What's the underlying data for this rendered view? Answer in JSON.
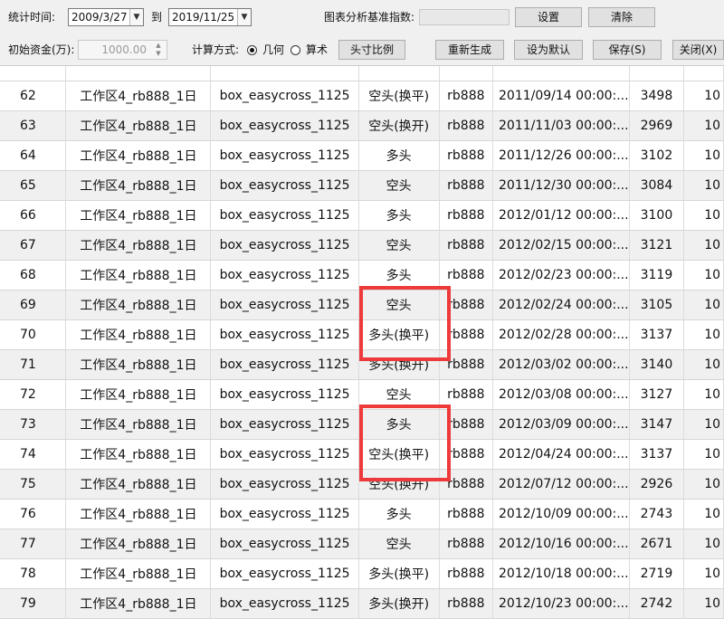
{
  "toolbar": {
    "stats_time_label": "统计时间:",
    "start_date": "2009/3/27",
    "to_label": "到",
    "end_date": "2019/11/25",
    "chart_index_label": "图表分析基准指数:",
    "settings_button": "设置",
    "clear_button": "清除",
    "initial_capital_label": "初始资金(万):",
    "initial_capital_value": "1000.00",
    "calc_method_label": "计算方式:",
    "geometric_label": "几何",
    "arithmetic_label": "算术",
    "selected_method": "几何",
    "position_ratio_button": "头寸比例",
    "regenerate_button": "重新生成",
    "set_default_button": "设为默认",
    "save_button": "保存(S)",
    "close_button": "关闭(X)"
  },
  "rows": [
    {
      "id": "62",
      "workspace": "工作区4_rb888_1日",
      "strategy": "box_easycross_1125",
      "direction": "空头(换平)",
      "symbol": "rb888",
      "time": "2011/09/14 00:00:...",
      "price": "3498",
      "tail": "10"
    },
    {
      "id": "63",
      "workspace": "工作区4_rb888_1日",
      "strategy": "box_easycross_1125",
      "direction": "空头(换开)",
      "symbol": "rb888",
      "time": "2011/11/03 00:00:...",
      "price": "2969",
      "tail": "10"
    },
    {
      "id": "64",
      "workspace": "工作区4_rb888_1日",
      "strategy": "box_easycross_1125",
      "direction": "多头",
      "symbol": "rb888",
      "time": "2011/12/26 00:00:...",
      "price": "3102",
      "tail": "10"
    },
    {
      "id": "65",
      "workspace": "工作区4_rb888_1日",
      "strategy": "box_easycross_1125",
      "direction": "空头",
      "symbol": "rb888",
      "time": "2011/12/30 00:00:...",
      "price": "3084",
      "tail": "10"
    },
    {
      "id": "66",
      "workspace": "工作区4_rb888_1日",
      "strategy": "box_easycross_1125",
      "direction": "多头",
      "symbol": "rb888",
      "time": "2012/01/12 00:00:...",
      "price": "3100",
      "tail": "10"
    },
    {
      "id": "67",
      "workspace": "工作区4_rb888_1日",
      "strategy": "box_easycross_1125",
      "direction": "空头",
      "symbol": "rb888",
      "time": "2012/02/15 00:00:...",
      "price": "3121",
      "tail": "10"
    },
    {
      "id": "68",
      "workspace": "工作区4_rb888_1日",
      "strategy": "box_easycross_1125",
      "direction": "多头",
      "symbol": "rb888",
      "time": "2012/02/23 00:00:...",
      "price": "3119",
      "tail": "10"
    },
    {
      "id": "69",
      "workspace": "工作区4_rb888_1日",
      "strategy": "box_easycross_1125",
      "direction": "空头",
      "symbol": "rb888",
      "time": "2012/02/24 00:00:...",
      "price": "3105",
      "tail": "10"
    },
    {
      "id": "70",
      "workspace": "工作区4_rb888_1日",
      "strategy": "box_easycross_1125",
      "direction": "多头(换平)",
      "symbol": "rb888",
      "time": "2012/02/28 00:00:...",
      "price": "3137",
      "tail": "10"
    },
    {
      "id": "71",
      "workspace": "工作区4_rb888_1日",
      "strategy": "box_easycross_1125",
      "direction": "多头(换开)",
      "symbol": "rb888",
      "time": "2012/03/02 00:00:...",
      "price": "3140",
      "tail": "10"
    },
    {
      "id": "72",
      "workspace": "工作区4_rb888_1日",
      "strategy": "box_easycross_1125",
      "direction": "空头",
      "symbol": "rb888",
      "time": "2012/03/08 00:00:...",
      "price": "3127",
      "tail": "10"
    },
    {
      "id": "73",
      "workspace": "工作区4_rb888_1日",
      "strategy": "box_easycross_1125",
      "direction": "多头",
      "symbol": "rb888",
      "time": "2012/03/09 00:00:...",
      "price": "3147",
      "tail": "10"
    },
    {
      "id": "74",
      "workspace": "工作区4_rb888_1日",
      "strategy": "box_easycross_1125",
      "direction": "空头(换平)",
      "symbol": "rb888",
      "time": "2012/04/24 00:00:...",
      "price": "3137",
      "tail": "10"
    },
    {
      "id": "75",
      "workspace": "工作区4_rb888_1日",
      "strategy": "box_easycross_1125",
      "direction": "空头(换开)",
      "symbol": "rb888",
      "time": "2012/07/12 00:00:...",
      "price": "2926",
      "tail": "10"
    },
    {
      "id": "76",
      "workspace": "工作区4_rb888_1日",
      "strategy": "box_easycross_1125",
      "direction": "多头",
      "symbol": "rb888",
      "time": "2012/10/09 00:00:...",
      "price": "2743",
      "tail": "10"
    },
    {
      "id": "77",
      "workspace": "工作区4_rb888_1日",
      "strategy": "box_easycross_1125",
      "direction": "空头",
      "symbol": "rb888",
      "time": "2012/10/16 00:00:...",
      "price": "2671",
      "tail": "10"
    },
    {
      "id": "78",
      "workspace": "工作区4_rb888_1日",
      "strategy": "box_easycross_1125",
      "direction": "多头(换平)",
      "symbol": "rb888",
      "time": "2012/10/18 00:00:...",
      "price": "2719",
      "tail": "10"
    },
    {
      "id": "79",
      "workspace": "工作区4_rb888_1日",
      "strategy": "box_easycross_1125",
      "direction": "多头(换开)",
      "symbol": "rb888",
      "time": "2012/10/23 00:00:...",
      "price": "2742",
      "tail": "10"
    }
  ],
  "highlight_color": "#ee3a3a",
  "highlighted_rows": [
    "70",
    "71",
    "74",
    "75"
  ]
}
